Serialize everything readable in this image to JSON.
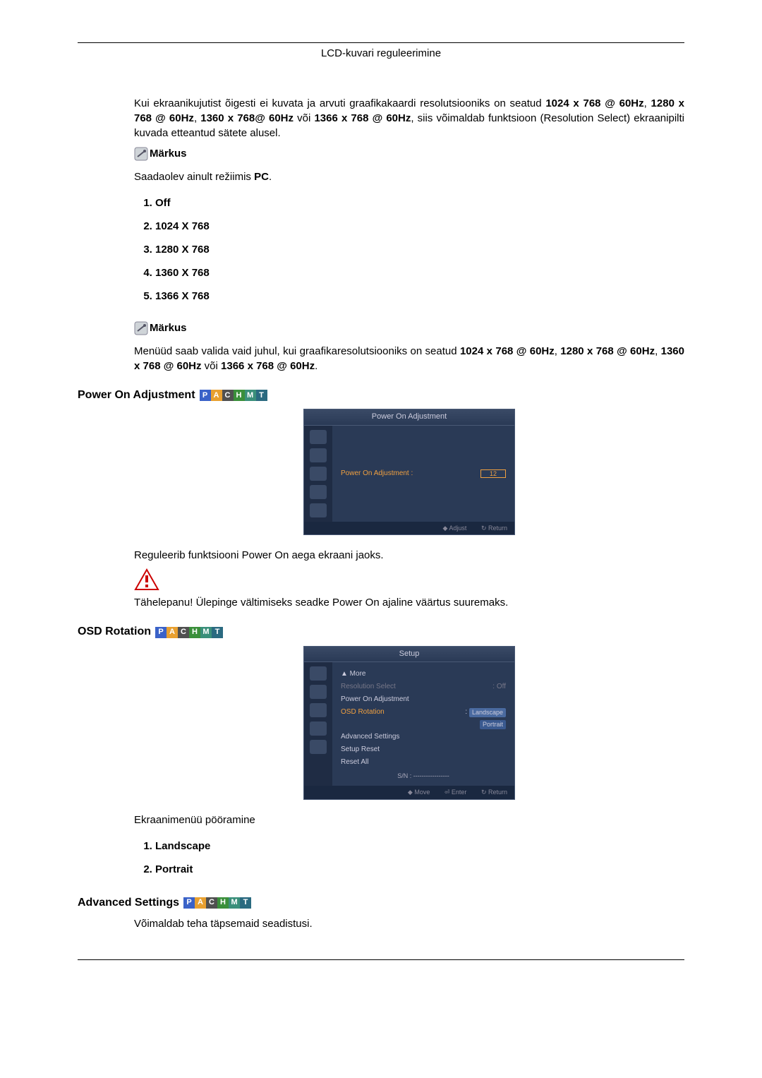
{
  "header": "LCD-kuvari reguleerimine",
  "intro": {
    "text_a": "Kui ekraanikujutist õigesti ei kuvata ja arvuti graafikakaardi resolutsiooniks on seatud ",
    "res1": "1024 x 768 @ 60Hz",
    "sep": ", ",
    "res2": "1280 x 768 @ 60Hz",
    "res3": "1360 x 768@ 60Hz",
    "or": " või ",
    "res4": "1366 x 768 @ 60Hz",
    "text_b": ", siis võimaldab funktsioon (Resolution Select) ekraanipilti kuvada etteantud sätete alusel."
  },
  "note_label": "Märkus",
  "note1": "Saadaolev ainult režiimis ",
  "note1_bold": "PC",
  "note1_dot": ".",
  "options": [
    "Off",
    "1024 X 768",
    "1280 X 768",
    "1360 X 768",
    "1366 X 768"
  ],
  "note2": {
    "a": "Menüüd saab valida vaid juhul, kui graafikaresolutsiooniks on seatud ",
    "r1": "1024 x 768 @ 60Hz",
    "r2": "1280 x 768 @ 60Hz",
    "r3": "1360 x 768 @ 60Hz",
    "or": " või ",
    "r4": "1366 x 768 @ 60Hz",
    "dot": "."
  },
  "sec1": {
    "title": "Power On Adjustment",
    "osd_title": "Power On Adjustment",
    "osd_label": "Power On Adjustment :",
    "osd_value": "12",
    "foot_adjust": "◆ Adjust",
    "foot_return": "↻ Return",
    "desc": "Reguleerib funktsiooni Power On aega ekraani jaoks.",
    "warn": "Tähelepanu! Ülepinge vältimiseks seadke Power On ajaline väärtus suuremaks."
  },
  "sec2": {
    "title": "OSD Rotation",
    "osd_title": "Setup",
    "more": "▲ More",
    "items": {
      "a": "Resolution Select",
      "a_val": ": Off",
      "b": "Power On Adjustment",
      "c": "OSD Rotation",
      "c_val1": "Landscape",
      "c_val2": "Portrait",
      "d": "Advanced Settings",
      "e": "Setup Reset",
      "f": "Reset All"
    },
    "sn": "S/N : -----------------",
    "foot_move": "◆ Move",
    "foot_enter": "⏎ Enter",
    "foot_return": "↻ Return",
    "desc": "Ekraanimenüü pööramine",
    "opts": [
      "Landscape",
      "Portrait"
    ]
  },
  "sec3": {
    "title": "Advanced Settings",
    "desc": "Võimaldab teha täpsemaid seadistusi."
  },
  "chips": {
    "p": "P",
    "a": "A",
    "c": "C",
    "h": "H",
    "m": "M",
    "t": "T"
  }
}
